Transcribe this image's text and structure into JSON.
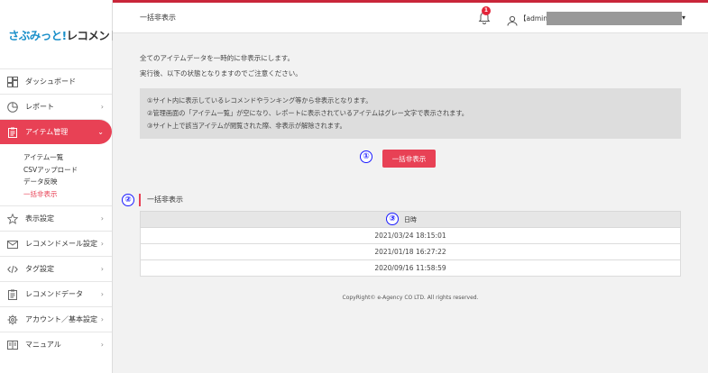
{
  "logo": {
    "part1": "さぶみっと!",
    "part2": " レコメンド"
  },
  "sidebar": {
    "items": [
      {
        "label": "ダッシュボード",
        "icon": "dashboard-icon"
      },
      {
        "label": "レポート",
        "icon": "report-icon"
      },
      {
        "label": "アイテム管理",
        "icon": "clipboard-icon"
      },
      {
        "label": "表示設定",
        "icon": "star-icon"
      },
      {
        "label": "レコメンドメール設定",
        "icon": "mail-icon"
      },
      {
        "label": "タグ設定",
        "icon": "code-icon"
      },
      {
        "label": "レコメンドデータ",
        "icon": "clipboard-icon"
      },
      {
        "label": "アカウント／基本設定",
        "icon": "gear-icon"
      },
      {
        "label": "マニュアル",
        "icon": "book-icon"
      }
    ],
    "subitems": [
      "アイテム一覧",
      "CSVアップロード",
      "データ反映",
      "一括非表示"
    ]
  },
  "header": {
    "title": "一括非表示",
    "notification_count": "1",
    "user_prefix": "【admin】"
  },
  "main": {
    "intro_line1": "全てのアイテムデータを一時的に非表示にします。",
    "intro_line2": "実行後、以下の状態となりますのでご注意ください。",
    "notes": [
      "①サイト内に表示しているレコメンドやランキング等から非表示となります。",
      "②管理画面の「アイテム一覧」が空になり、レポートに表示されているアイテムはグレー文字で表示されます。",
      "③サイト上で該当アイテムが閲覧された際、非表示が解除されます。"
    ],
    "button_label": "一括非表示",
    "section_title": "一括非表示",
    "table_header": "日時",
    "rows": [
      "2021/03/24 18:15:01",
      "2021/01/18 16:27:22",
      "2020/09/16 11:58:59"
    ],
    "copyright": "CopyRight© e-Agency CO LTD. All rights reserved."
  },
  "annotations": [
    "①",
    "②",
    "③"
  ],
  "colors": {
    "accent": "#e84155",
    "header_stripe": "#c9263a",
    "annotation": "#1a1aff",
    "logo_blue": "#1a8fc9"
  }
}
